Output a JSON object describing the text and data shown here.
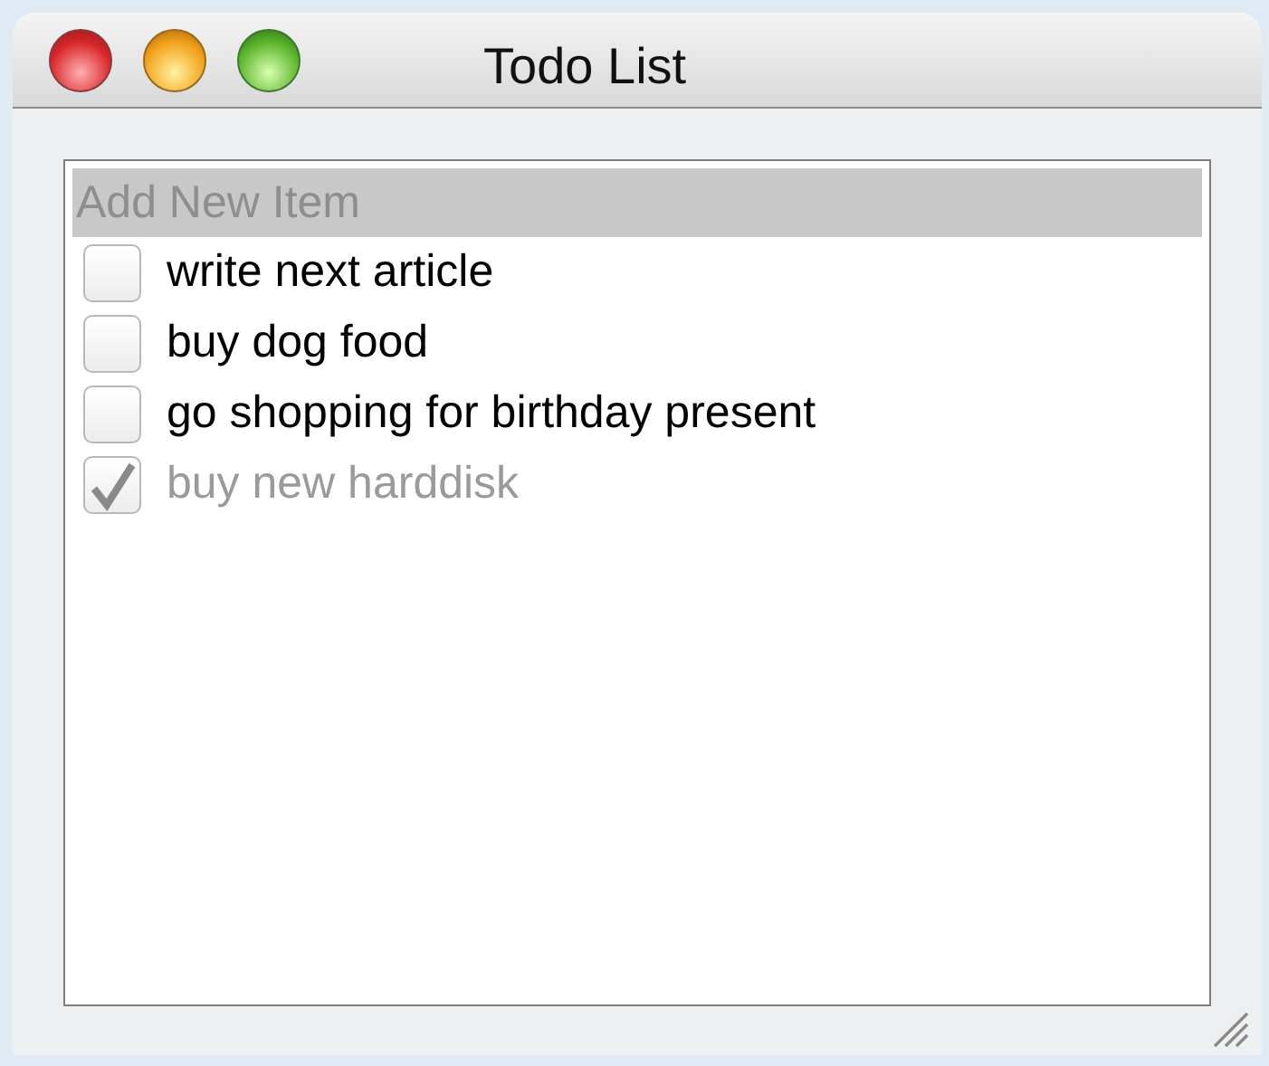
{
  "window": {
    "title": "Todo List"
  },
  "new_item": {
    "placeholder": "Add New Item"
  },
  "items": [
    {
      "label": "write next article",
      "checked": false
    },
    {
      "label": "buy dog food",
      "checked": false
    },
    {
      "label": "go shopping for birthday present",
      "checked": false
    },
    {
      "label": "buy new harddisk",
      "checked": true
    }
  ]
}
